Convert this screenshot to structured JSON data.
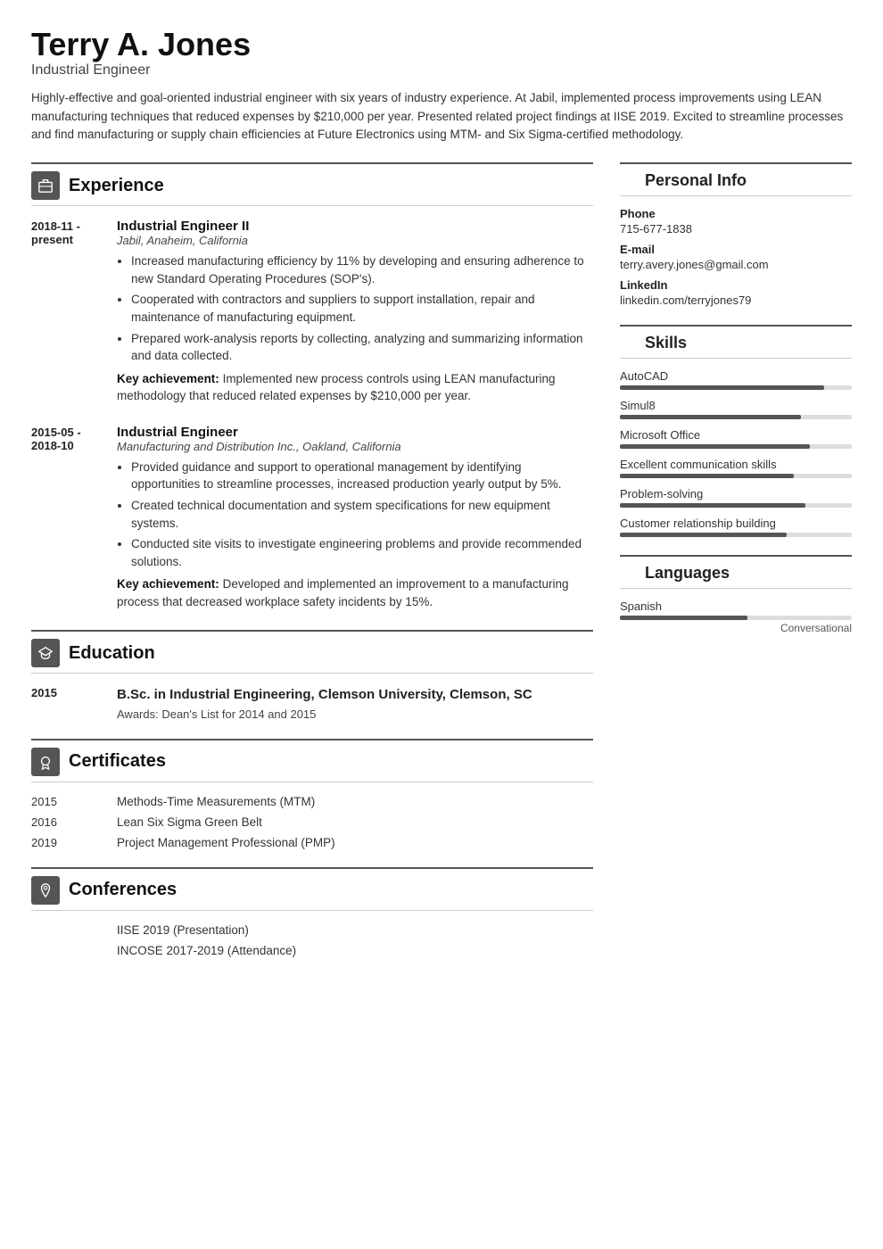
{
  "header": {
    "name": "Terry A. Jones",
    "title": "Industrial Engineer",
    "summary": "Highly-effective and goal-oriented industrial engineer with six years of industry experience. At Jabil, implemented process improvements using LEAN manufacturing techniques that reduced expenses by $210,000 per year. Presented related project findings at IISE 2019. Excited to streamline processes and find manufacturing or supply chain efficiencies at Future Electronics using MTM- and Six Sigma-certified methodology."
  },
  "sections": {
    "experience_label": "Experience",
    "education_label": "Education",
    "certificates_label": "Certificates",
    "conferences_label": "Conferences"
  },
  "experience": [
    {
      "dates": "2018-11 - present",
      "job_title": "Industrial Engineer II",
      "company": "Jabil, Anaheim, California",
      "bullets": [
        "Increased manufacturing efficiency by 11% by developing and ensuring adherence to new Standard Operating Procedures (SOP's).",
        "Cooperated with contractors and suppliers to support installation, repair and maintenance of manufacturing equipment.",
        "Prepared work-analysis reports by collecting, analyzing and summarizing information and data collected."
      ],
      "key_achievement": "Implemented new process controls using LEAN manufacturing methodology that reduced related expenses by $210,000 per year."
    },
    {
      "dates": "2015-05 - 2018-10",
      "job_title": "Industrial Engineer",
      "company": "Manufacturing and Distribution Inc., Oakland, California",
      "bullets": [
        "Provided guidance and support to operational management by identifying opportunities to streamline processes, increased production yearly output by 5%.",
        "Created technical documentation and system specifications for new equipment systems.",
        "Conducted site visits to investigate engineering problems and provide recommended solutions."
      ],
      "key_achievement": "Developed and implemented an improvement to a manufacturing process that decreased workplace safety incidents by 15%."
    }
  ],
  "education": [
    {
      "year": "2015",
      "degree": "B.Sc. in Industrial Engineering, Clemson University, Clemson, SC",
      "awards": "Awards: Dean's List for 2014 and 2015"
    }
  ],
  "certificates": [
    {
      "year": "2015",
      "name": "Methods-Time Measurements (MTM)"
    },
    {
      "year": "2016",
      "name": "Lean Six Sigma Green Belt"
    },
    {
      "year": "2019",
      "name": "Project Management Professional (PMP)"
    }
  ],
  "conferences": [
    {
      "name": "IISE 2019 (Presentation)"
    },
    {
      "name": "INCOSE 2017-2019 (Attendance)"
    }
  ],
  "personal_info": {
    "section_label": "Personal Info",
    "phone_label": "Phone",
    "phone": "715-677-1838",
    "email_label": "E-mail",
    "email": "terry.avery.jones@gmail.com",
    "linkedin_label": "LinkedIn",
    "linkedin": "linkedin.com/terryjones79"
  },
  "skills": {
    "section_label": "Skills",
    "items": [
      {
        "name": "AutoCAD",
        "pct": 88
      },
      {
        "name": "Simul8",
        "pct": 78
      },
      {
        "name": "Microsoft Office",
        "pct": 82
      },
      {
        "name": "Excellent communication skills",
        "pct": 75
      },
      {
        "name": "Problem-solving",
        "pct": 80
      },
      {
        "name": "Customer relationship building",
        "pct": 72
      }
    ]
  },
  "languages": {
    "section_label": "Languages",
    "items": [
      {
        "name": "Spanish",
        "pct": 55,
        "level": "Conversational"
      }
    ]
  }
}
